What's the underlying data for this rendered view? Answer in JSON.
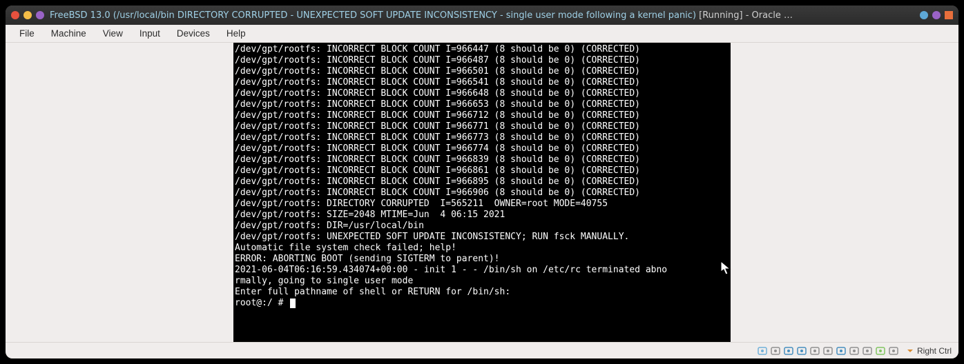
{
  "titlebar": {
    "dots": [
      "#e6513e",
      "#f4bd47",
      "#9a63c6"
    ],
    "vm_name": "FreeBSD 13.0",
    "detail": "(/usr/local/bin DIRECTORY CORRUPTED - UNEXPECTED SOFT UPDATE INCONSISTENCY - single user mode following a kernel panic)",
    "state": "[Running]",
    "app": "- Oracle …",
    "right_dots": [
      "#5ea8d6",
      "#9a63c6",
      "#e86f3c"
    ]
  },
  "menu": [
    "File",
    "Machine",
    "View",
    "Input",
    "Devices",
    "Help"
  ],
  "terminal": {
    "block_lines": [
      "/dev/gpt/rootfs: INCORRECT BLOCK COUNT I=966447 (8 should be 0) (CORRECTED)",
      "/dev/gpt/rootfs: INCORRECT BLOCK COUNT I=966487 (8 should be 0) (CORRECTED)",
      "/dev/gpt/rootfs: INCORRECT BLOCK COUNT I=966501 (8 should be 0) (CORRECTED)",
      "/dev/gpt/rootfs: INCORRECT BLOCK COUNT I=966541 (8 should be 0) (CORRECTED)",
      "/dev/gpt/rootfs: INCORRECT BLOCK COUNT I=966648 (8 should be 0) (CORRECTED)",
      "/dev/gpt/rootfs: INCORRECT BLOCK COUNT I=966653 (8 should be 0) (CORRECTED)",
      "/dev/gpt/rootfs: INCORRECT BLOCK COUNT I=966712 (8 should be 0) (CORRECTED)",
      "/dev/gpt/rootfs: INCORRECT BLOCK COUNT I=966771 (8 should be 0) (CORRECTED)",
      "/dev/gpt/rootfs: INCORRECT BLOCK COUNT I=966773 (8 should be 0) (CORRECTED)",
      "/dev/gpt/rootfs: INCORRECT BLOCK COUNT I=966774 (8 should be 0) (CORRECTED)",
      "/dev/gpt/rootfs: INCORRECT BLOCK COUNT I=966839 (8 should be 0) (CORRECTED)",
      "/dev/gpt/rootfs: INCORRECT BLOCK COUNT I=966861 (8 should be 0) (CORRECTED)",
      "/dev/gpt/rootfs: INCORRECT BLOCK COUNT I=966895 (8 should be 0) (CORRECTED)",
      "/dev/gpt/rootfs: INCORRECT BLOCK COUNT I=966906 (8 should be 0) (CORRECTED)",
      "/dev/gpt/rootfs: DIRECTORY CORRUPTED  I=565211  OWNER=root MODE=40755",
      "/dev/gpt/rootfs: SIZE=2048 MTIME=Jun  4 06:15 2021 ",
      "/dev/gpt/rootfs: DIR=/usr/local/bin",
      "",
      "/dev/gpt/rootfs: UNEXPECTED SOFT UPDATE INCONSISTENCY; RUN fsck MANUALLY.",
      "Automatic file system check failed; help!",
      "ERROR: ABORTING BOOT (sending SIGTERM to parent)!",
      "2021-06-04T06:16:59.434074+00:00 - init 1 - - /bin/sh on /etc/rc terminated abno",
      "rmally, going to single user mode",
      "Enter full pathname of shell or RETURN for /bin/sh:"
    ],
    "prompt": "root@:/ # "
  },
  "status": {
    "icons": [
      {
        "name": "hard-disk-icon",
        "color": "#5aa7d6"
      },
      {
        "name": "optical-disk-icon",
        "color": "#808080"
      },
      {
        "name": "usb-icon",
        "color": "#2a7fb8"
      },
      {
        "name": "shared-folder-icon",
        "color": "#2a7fb8"
      },
      {
        "name": "display-icon",
        "color": "#808080"
      },
      {
        "name": "audio-icon",
        "color": "#808080"
      },
      {
        "name": "network-icon",
        "color": "#2a7fb8"
      },
      {
        "name": "recording-icon",
        "color": "#808080"
      },
      {
        "name": "camera-icon",
        "color": "#808080"
      },
      {
        "name": "mouse-integration-icon",
        "color": "#6fbf4b"
      },
      {
        "name": "clipboard-icon",
        "color": "#808080"
      }
    ],
    "hostkey": "Right Ctrl"
  }
}
